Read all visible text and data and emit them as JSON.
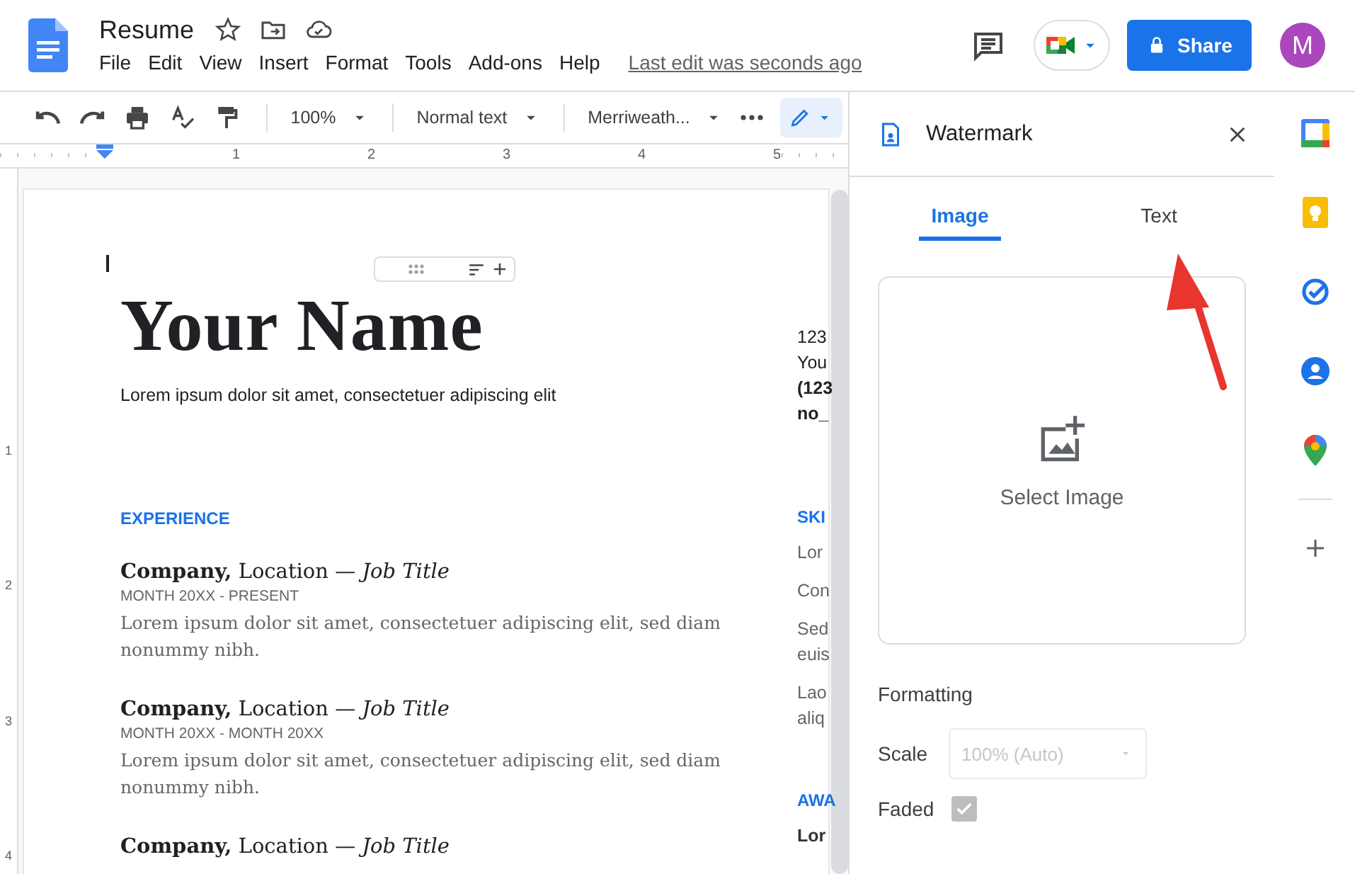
{
  "header": {
    "title": "Resume",
    "menus": [
      "File",
      "Edit",
      "View",
      "Insert",
      "Format",
      "Tools",
      "Add-ons",
      "Help"
    ],
    "last_edit": "Last edit was seconds ago",
    "share": "Share",
    "avatar": "M"
  },
  "toolbar": {
    "zoom": "100%",
    "style": "Normal text",
    "font": "Merriweath..."
  },
  "ruler": {
    "marks": [
      "1",
      "2",
      "3",
      "4",
      "5"
    ],
    "side_marks": [
      "1",
      "2",
      "3",
      "4"
    ]
  },
  "document": {
    "name": "Your Name",
    "tagline": "Lorem ipsum dolor sit amet, consectetuer adipiscing elit",
    "section": "EXPERIENCE",
    "jobs": [
      {
        "heading": "**Company,** Location — *Job Title*",
        "dates": "MONTH 20XX - PRESENT",
        "description": "Lorem ipsum dolor sit amet, consectetuer adipiscing elit, sed diam nonummy nibh."
      },
      {
        "heading": "**Company,** Location — *Job Title*",
        "dates": "MONTH 20XX - MONTH 20XX",
        "description": "Lorem ipsum dolor sit amet, consectetuer adipiscing elit, sed diam nonummy nibh."
      },
      {
        "heading": "**Company,** Location — *Job Title*"
      }
    ],
    "side_column": {
      "contact": [
        {
          "text": "123",
          "kind": "plain"
        },
        {
          "text": "You",
          "kind": "plain"
        },
        {
          "text": "(123",
          "kind": "bold"
        },
        {
          "text": "no_",
          "kind": "bold"
        }
      ],
      "sections": [
        {
          "heading": "SKI",
          "items": [
            {
              "lines": [
                "Lor"
              ],
              "kind": "plain"
            },
            {
              "lines": [
                "Con"
              ],
              "kind": "plain"
            },
            {
              "lines": [
                "Sed",
                "euis"
              ],
              "kind": "plain"
            },
            {
              "lines": [
                "Lao",
                "aliq"
              ],
              "kind": "plain"
            }
          ]
        },
        {
          "heading": "AWA",
          "items": [
            {
              "lines": [
                "Lor"
              ],
              "kind": "bold"
            }
          ]
        }
      ]
    }
  },
  "panel": {
    "title": "Watermark",
    "tabs": [
      {
        "label": "Image",
        "selected": true
      },
      {
        "label": "Text",
        "selected": false
      }
    ],
    "select_image": "Select Image",
    "formatting": "Formatting",
    "scale": {
      "label": "Scale",
      "value": "100% (Auto)",
      "disabled": true
    },
    "faded": {
      "label": "Faded",
      "checked": true,
      "disabled": true
    }
  }
}
